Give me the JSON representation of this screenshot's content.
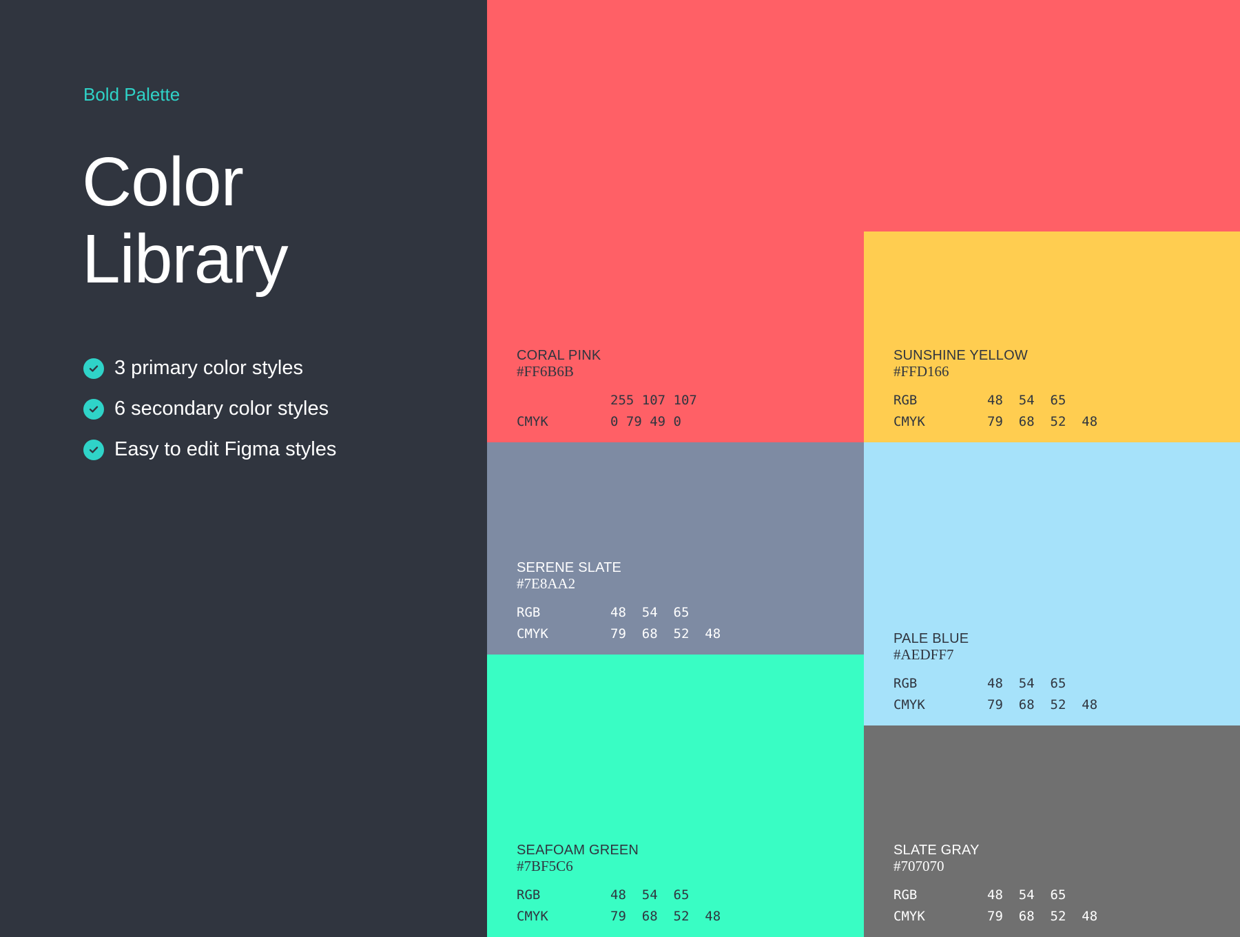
{
  "sidebar": {
    "eyebrow": "Bold Palette",
    "title_line1": "Color",
    "title_line2": "Library",
    "accent_color": "#2fd3c8",
    "background_color": "#30353f",
    "features": [
      {
        "icon": "check-circle-icon",
        "label": "3 primary color styles"
      },
      {
        "icon": "check-circle-icon",
        "label": "6 secondary color styles"
      },
      {
        "icon": "check-circle-icon",
        "label": "Easy to edit Figma styles"
      }
    ]
  },
  "swatches": [
    {
      "id": "coral-pink",
      "name": "CORAL PINK",
      "hex": "#FF6B6B",
      "fill": "#ff6066",
      "rgb_label": "",
      "rgb": "255 107 107",
      "cmyk_label": "CMYK",
      "cmyk": "0 79 49 0"
    },
    {
      "id": "sunshine-yellow",
      "name": "SUNSHINE YELLOW",
      "hex": "#FFD166",
      "fill": "#ffcd50",
      "rgb_label": "RGB",
      "rgb": "48  54  65",
      "cmyk_label": "CMYK",
      "cmyk": "79  68  52  48"
    },
    {
      "id": "serene-slate",
      "name": "SERENE SLATE",
      "hex": "#7E8AA2",
      "fill": "#7e8ba3",
      "rgb_label": "RGB",
      "rgb": "48  54  65",
      "cmyk_label": "CMYK",
      "cmyk": "79  68  52  48"
    },
    {
      "id": "pale-blue",
      "name": "PALE BLUE",
      "hex": "#AEDFF7",
      "fill": "#a6e2fa",
      "rgb_label": "RGB",
      "rgb": "48  54  65",
      "cmyk_label": "CMYK",
      "cmyk": "79  68  52  48"
    },
    {
      "id": "seafoam-green",
      "name": "SEAFOAM GREEN",
      "hex": "#7BF5C6",
      "fill": "#39fdc4",
      "rgb_label": "RGB",
      "rgb": "48  54  65",
      "cmyk_label": "CMYK",
      "cmyk": "79  68  52  48"
    },
    {
      "id": "slate-gray",
      "name": "SLATE GRAY",
      "hex": "#707070",
      "fill": "#707070",
      "rgb_label": "RGB",
      "rgb": "48  54  65",
      "cmyk_label": "CMYK",
      "cmyk": "79  68  52  48"
    }
  ]
}
